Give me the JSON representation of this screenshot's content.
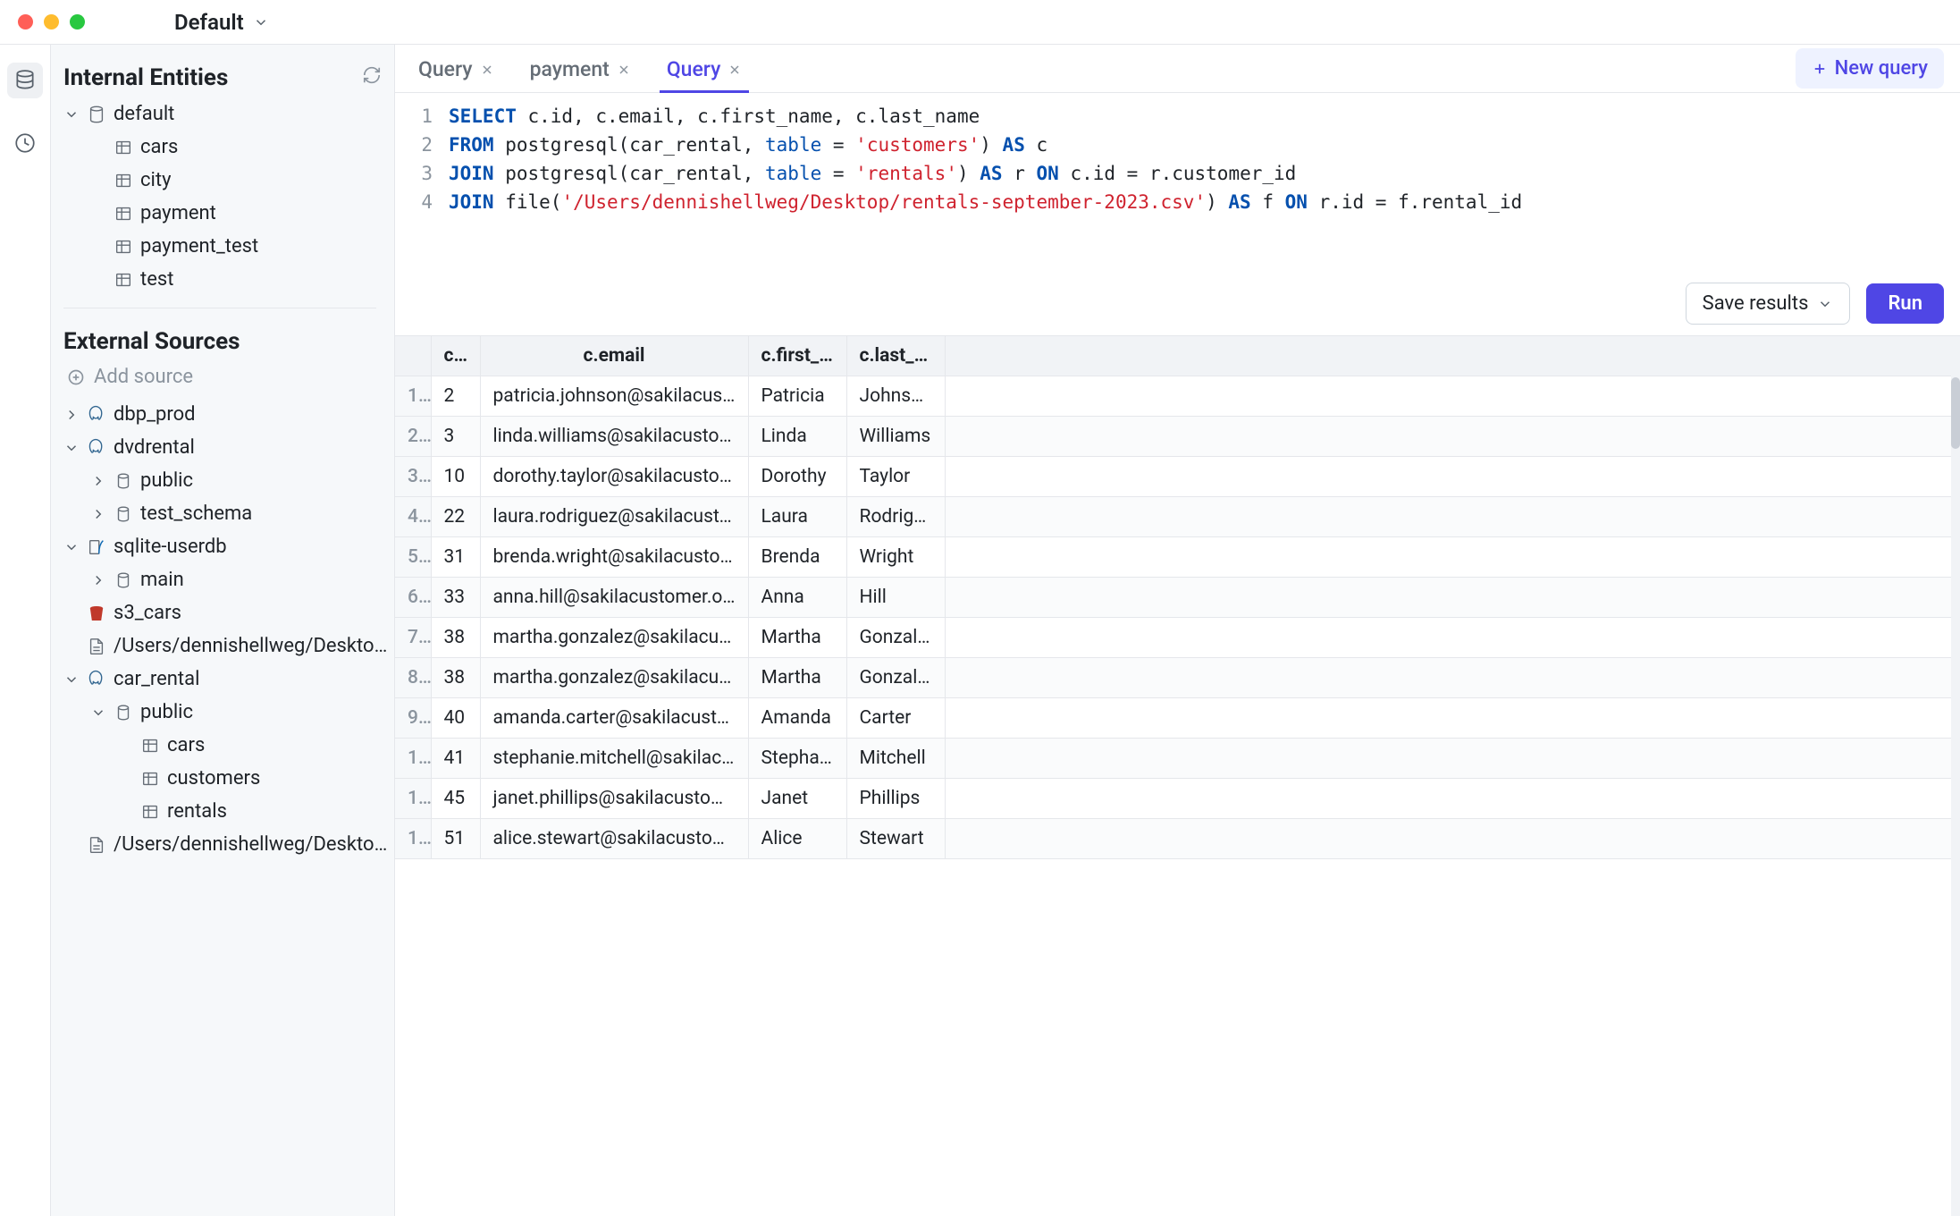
{
  "titlebar": {
    "workspace": "Default"
  },
  "sidebar": {
    "internal_title": "Internal Entities",
    "external_title": "External Sources",
    "add_source_label": "Add source",
    "internal_tree": {
      "root": "default",
      "tables": [
        "cars",
        "city",
        "payment",
        "payment_test",
        "test"
      ]
    },
    "external_tree": [
      {
        "type": "pg",
        "label": "dbp_prod",
        "expanded": false
      },
      {
        "type": "pg",
        "label": "dvdrental",
        "expanded": true,
        "children": [
          {
            "type": "schema",
            "label": "public"
          },
          {
            "type": "schema",
            "label": "test_schema"
          }
        ]
      },
      {
        "type": "sqlite",
        "label": "sqlite-userdb",
        "expanded": true,
        "children": [
          {
            "type": "schema",
            "label": "main"
          }
        ]
      },
      {
        "type": "s3",
        "label": "s3_cars"
      },
      {
        "type": "file",
        "label": "/Users/dennishellweg/Desktop/emails.csv"
      },
      {
        "type": "pg",
        "label": "car_rental",
        "expanded": true,
        "children": [
          {
            "type": "schema",
            "label": "public",
            "expanded": true,
            "children": [
              {
                "type": "table",
                "label": "cars"
              },
              {
                "type": "table",
                "label": "customers"
              },
              {
                "type": "table",
                "label": "rentals"
              }
            ]
          }
        ]
      },
      {
        "type": "file",
        "label": "/Users/dennishellweg/Desktop/rentals-sept"
      }
    ]
  },
  "tabs": [
    {
      "label": "Query",
      "active": false
    },
    {
      "label": "payment",
      "active": false
    },
    {
      "label": "Query",
      "active": true
    }
  ],
  "new_query_label": "New query",
  "editor": {
    "lines": [
      {
        "n": 1,
        "tokens": [
          [
            "kw",
            "SELECT"
          ],
          [
            "",
            " c.id, c.email, c.first_name, c.last_name"
          ]
        ]
      },
      {
        "n": 2,
        "tokens": [
          [
            "kw",
            "FROM"
          ],
          [
            "",
            " postgresql(car_rental, "
          ],
          [
            "ident",
            "table"
          ],
          [
            "",
            " = "
          ],
          [
            "str",
            "'customers'"
          ],
          [
            "",
            ") "
          ],
          [
            "kw",
            "AS"
          ],
          [
            "",
            " c"
          ]
        ]
      },
      {
        "n": 3,
        "tokens": [
          [
            "kw",
            "JOIN"
          ],
          [
            "",
            " postgresql(car_rental, "
          ],
          [
            "ident",
            "table"
          ],
          [
            "",
            " = "
          ],
          [
            "str",
            "'rentals'"
          ],
          [
            "",
            ") "
          ],
          [
            "kw",
            "AS"
          ],
          [
            "",
            " r "
          ],
          [
            "kw",
            "ON"
          ],
          [
            "",
            " c.id = r.customer_id"
          ]
        ]
      },
      {
        "n": 4,
        "tokens": [
          [
            "kw",
            "JOIN"
          ],
          [
            "",
            " file("
          ],
          [
            "str",
            "'/Users/dennishellweg/Desktop/rentals-september-2023.csv'"
          ],
          [
            "",
            ") "
          ],
          [
            "kw",
            "AS"
          ],
          [
            "",
            " f "
          ],
          [
            "kw",
            "ON"
          ],
          [
            "",
            " r.id = f.rental_id"
          ]
        ]
      }
    ]
  },
  "actions": {
    "save_label": "Save results",
    "run_label": "Run"
  },
  "results": {
    "columns": [
      "c.id",
      "c.email",
      "c.first_name",
      "c.last_name"
    ],
    "rows": [
      [
        2,
        "patricia.johnson@sakilacustomer.org",
        "Patricia",
        "Johnson"
      ],
      [
        3,
        "linda.williams@sakilacustomer.org",
        "Linda",
        "Williams"
      ],
      [
        10,
        "dorothy.taylor@sakilacustomer.org",
        "Dorothy",
        "Taylor"
      ],
      [
        22,
        "laura.rodriguez@sakilacustomer.org",
        "Laura",
        "Rodriguez"
      ],
      [
        31,
        "brenda.wright@sakilacustomer.org",
        "Brenda",
        "Wright"
      ],
      [
        33,
        "anna.hill@sakilacustomer.org",
        "Anna",
        "Hill"
      ],
      [
        38,
        "martha.gonzalez@sakilacustomer.org",
        "Martha",
        "Gonzalez"
      ],
      [
        38,
        "martha.gonzalez@sakilacustomer.org",
        "Martha",
        "Gonzalez"
      ],
      [
        40,
        "amanda.carter@sakilacustomer.org",
        "Amanda",
        "Carter"
      ],
      [
        41,
        "stephanie.mitchell@sakilacustomer.org",
        "Stephanie",
        "Mitchell"
      ],
      [
        45,
        "janet.phillips@sakilacustomer.org",
        "Janet",
        "Phillips"
      ],
      [
        51,
        "alice.stewart@sakilacustomer.org",
        "Alice",
        "Stewart"
      ]
    ]
  }
}
